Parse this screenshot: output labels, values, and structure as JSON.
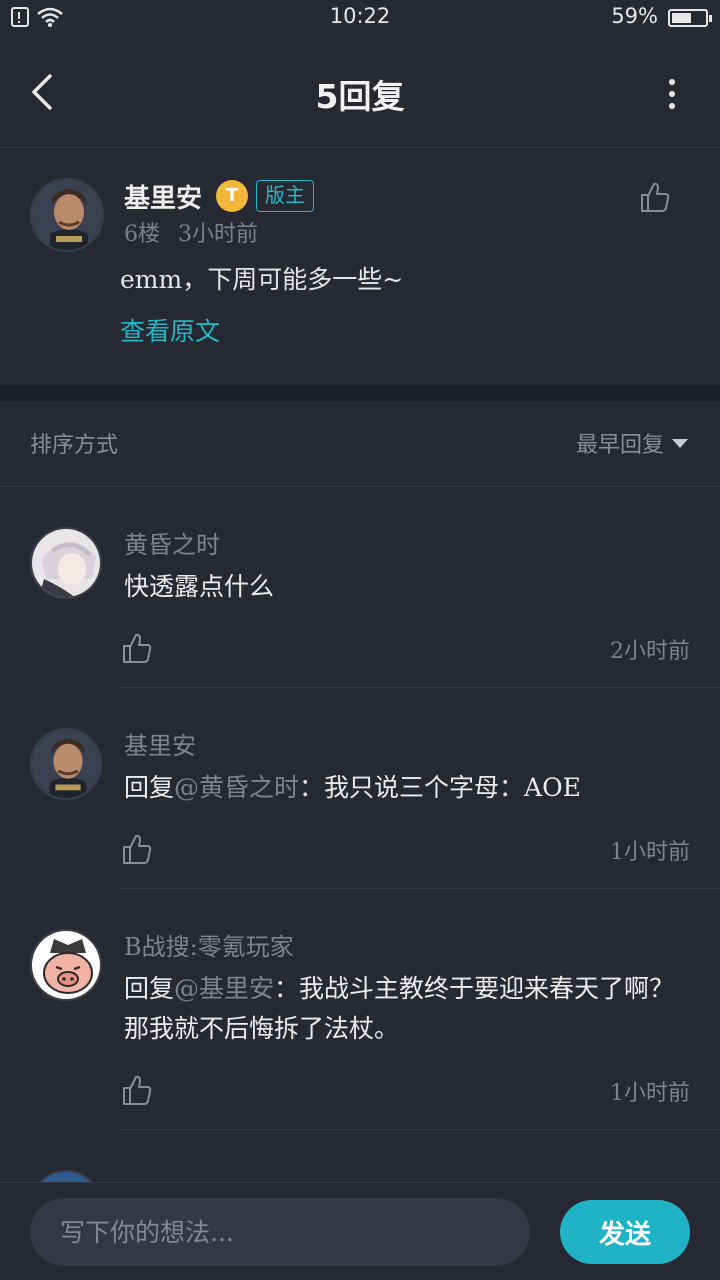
{
  "status_bar": {
    "time": "10:22",
    "battery_percent": "59%",
    "battery_level": 0.59
  },
  "header": {
    "title": "5回复"
  },
  "main_post": {
    "author": "基里安",
    "coin_badge": "T",
    "role_badge": "版主",
    "floor": "6楼",
    "time": "3小时前",
    "content": "emm，下周可能多一些~",
    "view_original": "查看原文"
  },
  "sort": {
    "label": "排序方式",
    "selected": "最早回复"
  },
  "replies": [
    {
      "name": "黄昏之时",
      "text_prefix": "",
      "mention": "",
      "text": "快透露点什么",
      "time": "2小时前"
    },
    {
      "name": "基里安",
      "text_prefix": "回复",
      "mention": "@黄昏之时",
      "text": "：我只说三个字母：AOE",
      "time": "1小时前"
    },
    {
      "name": "B战搜:零氪玩家",
      "text_prefix": "回复",
      "mention": "@基里安",
      "text": "：我战斗主教终于要迎来春天了啊？那我就不后悔拆了法杖。",
      "time": "1小时前"
    }
  ],
  "composer": {
    "placeholder": "写下你的想法...",
    "send_label": "发送"
  },
  "colors": {
    "background": "#262932",
    "accent": "#1fb3c5",
    "coin": "#f3b73a"
  }
}
